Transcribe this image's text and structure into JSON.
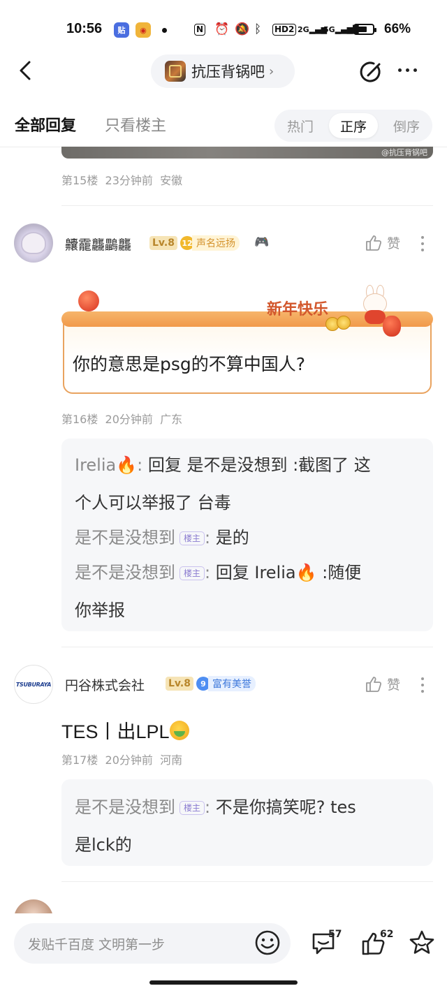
{
  "status_bar": {
    "time": "10:56",
    "app_icons": [
      "tieba-app-icon",
      "weibo-app-icon"
    ],
    "battery_percent": "66%",
    "battery_level": 0.66,
    "network_labels": [
      "HD2",
      "2G",
      "5G"
    ]
  },
  "header": {
    "forum_name": "抗压背锅吧",
    "chevron": "›"
  },
  "tabs": {
    "all_replies": "全部回复",
    "only_op": "只看楼主",
    "sort": [
      {
        "label": "热门",
        "active": false
      },
      {
        "label": "正序",
        "active": true
      },
      {
        "label": "倒序",
        "active": false
      }
    ]
  },
  "prev_post": {
    "image_watermark": "@抗压背锅吧",
    "floor": "第15楼",
    "time": "23分钟前",
    "location": "安徽"
  },
  "posts": [
    {
      "username": "齉靇龘鸓龘",
      "level": "Lv.8",
      "honor_num": "12",
      "honor_text": "声名远扬",
      "like_label": "赞",
      "festive_banner": "新年快乐",
      "content": "你的意思是psg的不算中国人?",
      "floor": "第16楼",
      "time": "20分钟前",
      "location": "广东",
      "replies": [
        {
          "name": "Irelia🔥",
          "sep": ":",
          "line1": " 回复 是不是没想到 :截图了 这",
          "line2": "个人可以举报了 台毒"
        },
        {
          "name": "是不是没想到",
          "op_tag": "楼主",
          "sep": ":",
          "line1": " 是的"
        },
        {
          "name": "是不是没想到",
          "op_tag": "楼主",
          "sep": ":",
          "line1": " 回复 Irelia🔥 :随便",
          "line2": "你举报"
        }
      ]
    },
    {
      "username": "円谷株式会社",
      "avatar_text": "TSUBURAYA",
      "level": "Lv.8",
      "honor_num": "9",
      "honor_text": "富有美誉",
      "like_label": "赞",
      "content": "TES丨出LPL",
      "floor": "第17楼",
      "time": "20分钟前",
      "location": "河南",
      "replies": [
        {
          "name": "是不是没想到",
          "op_tag": "楼主",
          "sep": ":",
          "line1": " 不是你搞笑呢? tes",
          "line2": "是lck的"
        }
      ]
    }
  ],
  "bottom_bar": {
    "input_placeholder": "发贴千百度 文明第一步",
    "comment_count": "57",
    "like_count": "62"
  }
}
